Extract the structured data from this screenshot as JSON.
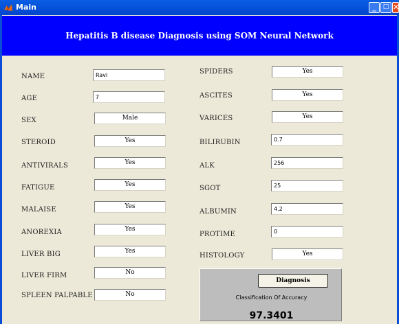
{
  "window": {
    "title": "Main"
  },
  "banner": {
    "title": "Hepatitis B disease Diagnosis using SOM Neural Network"
  },
  "left_fields": [
    {
      "label": "NAME",
      "value": "Ravi"
    },
    {
      "label": "AGE",
      "value": "7"
    },
    {
      "label": "SEX",
      "value": "Male"
    },
    {
      "label": "STEROID",
      "value": "Yes"
    },
    {
      "label": "ANTIVIRALS",
      "value": "Yes"
    },
    {
      "label": "FATIGUE",
      "value": "Yes"
    },
    {
      "label": "MALAISE",
      "value": "Yes"
    },
    {
      "label": "ANOREXIA",
      "value": "Yes"
    },
    {
      "label": "LIVER BIG",
      "value": "Yes"
    },
    {
      "label": "LIVER FIRM",
      "value": "No"
    },
    {
      "label": "SPLEEN PALPABLE",
      "value": "No"
    }
  ],
  "right_fields": [
    {
      "label": "SPIDERS",
      "value": "Yes"
    },
    {
      "label": "ASCITES",
      "value": "Yes"
    },
    {
      "label": "VARICES",
      "value": "Yes"
    },
    {
      "label": "BILIRUBIN",
      "value": "0.7"
    },
    {
      "label": "ALK",
      "value": "256"
    },
    {
      "label": "SGOT",
      "value": "25"
    },
    {
      "label": "ALBUMIN",
      "value": "4.2"
    },
    {
      "label": "PROTIME",
      "value": "0"
    },
    {
      "label": "HISTOLOGY",
      "value": "Yes"
    }
  ],
  "result": {
    "button_label": "Diagnosis",
    "accuracy_label": "Classification Of Accuracy",
    "accuracy_value": "97.3401"
  },
  "colors": {
    "banner": "#0000ff",
    "background": "#ece9d8",
    "titlebar": "#0044cc"
  },
  "icons": {
    "app": "matlab-icon",
    "minimize": "minimize-icon",
    "maximize": "maximize-icon",
    "close": "close-icon"
  }
}
